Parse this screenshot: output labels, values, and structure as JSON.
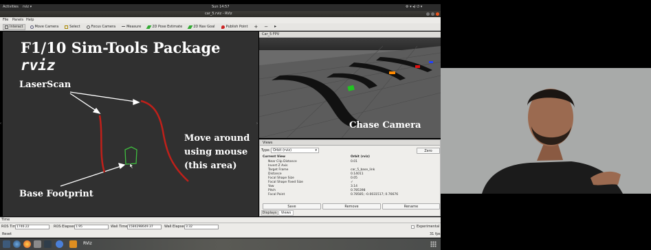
{
  "system_bar": {
    "activities": "Activities",
    "app_menu": "rviz ▾",
    "clock": "Sun 14:57",
    "tray": "⚙  ▾ ◂) ⏻ ▾"
  },
  "window": {
    "title": "car_5.rviz - RViz"
  },
  "menu": {
    "items": [
      "File",
      "Panels",
      "Help"
    ]
  },
  "toolbar": {
    "tools": [
      {
        "label": "Interact",
        "icon": "interact-icon"
      },
      {
        "label": "Move Camera",
        "icon": "move-camera-icon"
      },
      {
        "label": "Select",
        "icon": "select-icon"
      },
      {
        "label": "Focus Camera",
        "icon": "focus-camera-icon"
      },
      {
        "label": "Measure",
        "icon": "measure-icon"
      },
      {
        "label": "2D Pose Estimate",
        "icon": "pose-estimate-icon"
      },
      {
        "label": "2D Nav Goal",
        "icon": "nav-goal-icon"
      },
      {
        "label": "Publish Point",
        "icon": "publish-point-icon"
      }
    ]
  },
  "view3d": {
    "title_main": "F1/10 Sim-Tools Package",
    "title_mono": "rviz",
    "laser_label": "LaserScan",
    "footprint_label": "Base Footprint",
    "move_label": [
      "Move around",
      "using mouse",
      "(this area)"
    ]
  },
  "camera_panel": {
    "title": "Car_5 FPV",
    "overlay": "Chase Camera"
  },
  "views_panel": {
    "title": "Views",
    "type_label": "Type:",
    "type_value": "Orbit (rviz)",
    "zero_button": "Zero",
    "current_view": {
      "label": "Current View",
      "value": "Orbit (rviz)"
    },
    "properties": [
      {
        "k": "Near Clip Distance",
        "v": "0.01"
      },
      {
        "k": "Invert Z Axis",
        "v": ""
      },
      {
        "k": "Target Frame",
        "v": "car_5_base_link"
      },
      {
        "k": "Distance",
        "v": "0.14011"
      },
      {
        "k": "Focal Shape Size",
        "v": "0.05"
      },
      {
        "k": "Focal Shape Fixed Size",
        "v": "✓"
      },
      {
        "k": "Yaw",
        "v": "3.14"
      },
      {
        "k": "Pitch",
        "v": "0.785398"
      },
      {
        "k": "Focal Point",
        "v": "0.78585; -0.0031517; 0.76676"
      }
    ],
    "buttons": {
      "save": "Save",
      "remove": "Remove",
      "rename": "Rename"
    },
    "tabs": [
      "Displays",
      "Views"
    ]
  },
  "time_panel": {
    "title": "Time",
    "ros_time_label": "ROS Time:",
    "ros_time": "1746.22",
    "ros_elapsed_label": "ROS Elapsed:",
    "ros_elapsed": "1.95",
    "wall_time_label": "Wall Time:",
    "wall_time": "1584298649.37",
    "wall_elapsed_label": "Wall Elapsed:",
    "wall_elapsed": "3.32",
    "experimental": "Experimental",
    "reset": "Reset",
    "fps": "31 fps"
  },
  "taskbar": {
    "rviz_label": "RViz"
  },
  "colors": {
    "laser": "#c0201a",
    "footprint": "#3fbf3f",
    "panel_bg": "#efeeeb",
    "ubuntu_orange": "#e95420"
  }
}
